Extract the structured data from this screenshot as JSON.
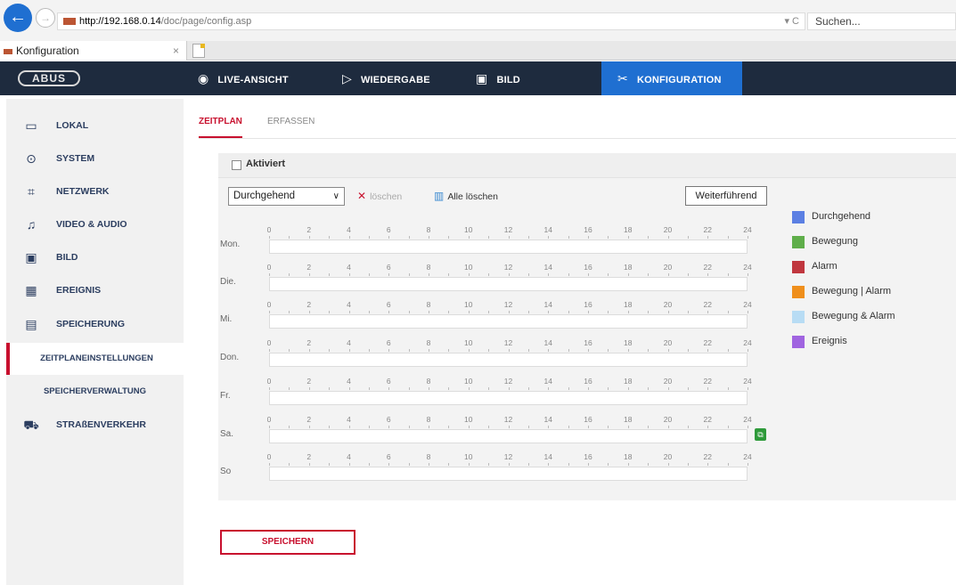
{
  "browser": {
    "url_host": "http://192.168.0.14",
    "url_path": "/doc/page/config.asp",
    "url_controls": "▾ C",
    "search_placeholder": "Suchen...",
    "back_glyph": "←",
    "forward_glyph": "→",
    "tab_title": "Konfiguration",
    "tab_close": "×"
  },
  "app": {
    "logo": "ABUS",
    "nav": [
      {
        "icon": "eye-icon",
        "glyph": "◉",
        "label": "LIVE-ANSICHT"
      },
      {
        "icon": "play-icon",
        "glyph": "▷",
        "label": "WIEDERGABE"
      },
      {
        "icon": "image-icon",
        "glyph": "▣",
        "label": "BILD"
      },
      {
        "icon": "tools-icon",
        "glyph": "✂",
        "label": "KONFIGURATION"
      }
    ]
  },
  "sidebar": {
    "items": [
      {
        "icon": "monitor-icon",
        "glyph": "▭",
        "label": "LOKAL"
      },
      {
        "icon": "system-icon",
        "glyph": "⊙",
        "label": "SYSTEM"
      },
      {
        "icon": "network-icon",
        "glyph": "⌗",
        "label": "NETZWERK"
      },
      {
        "icon": "video-audio-icon",
        "glyph": "♫",
        "label": "VIDEO & AUDIO"
      },
      {
        "icon": "image-icon",
        "glyph": "▣",
        "label": "BILD"
      },
      {
        "icon": "event-icon",
        "glyph": "▦",
        "label": "EREIGNIS"
      },
      {
        "icon": "storage-icon",
        "glyph": "▤",
        "label": "SPEICHERUNG"
      },
      {
        "icon": "traffic-icon",
        "glyph": "⛟",
        "label": "STRAßENVERKEHR"
      }
    ],
    "subitems": [
      "ZEITPLANEINSTELLUNGEN",
      "SPEICHERVERWALTUNG"
    ]
  },
  "content": {
    "tabs": [
      "ZEITPLAN",
      "ERFASSEN"
    ],
    "enabled_label": "Aktiviert",
    "mode_selected": "Durchgehend",
    "select_caret": "∨",
    "delete_label": "löschen",
    "delete_glyph": "✕",
    "delete_all_label": "Alle löschen",
    "trash_glyph": "▥",
    "more_label": "Weiterführend",
    "days": [
      "Mon.",
      "Die.",
      "Mi.",
      "Don.",
      "Fr.",
      "Sa.",
      "So"
    ],
    "hours": [
      "0",
      "2",
      "4",
      "6",
      "8",
      "10",
      "12",
      "14",
      "16",
      "18",
      "20",
      "22",
      "24"
    ],
    "copy_glyph": "⧉",
    "save_label": "SPEICHERN"
  },
  "legend": [
    {
      "label": "Durchgehend",
      "color": "#5b7fe3"
    },
    {
      "label": "Bewegung",
      "color": "#5fae4a"
    },
    {
      "label": "Alarm",
      "color": "#c0363e"
    },
    {
      "label": "Bewegung | Alarm",
      "color": "#ef8f1c"
    },
    {
      "label": "Bewegung & Alarm",
      "color": "#b8dcf4"
    },
    {
      "label": "Ereignis",
      "color": "#a064e0"
    }
  ]
}
